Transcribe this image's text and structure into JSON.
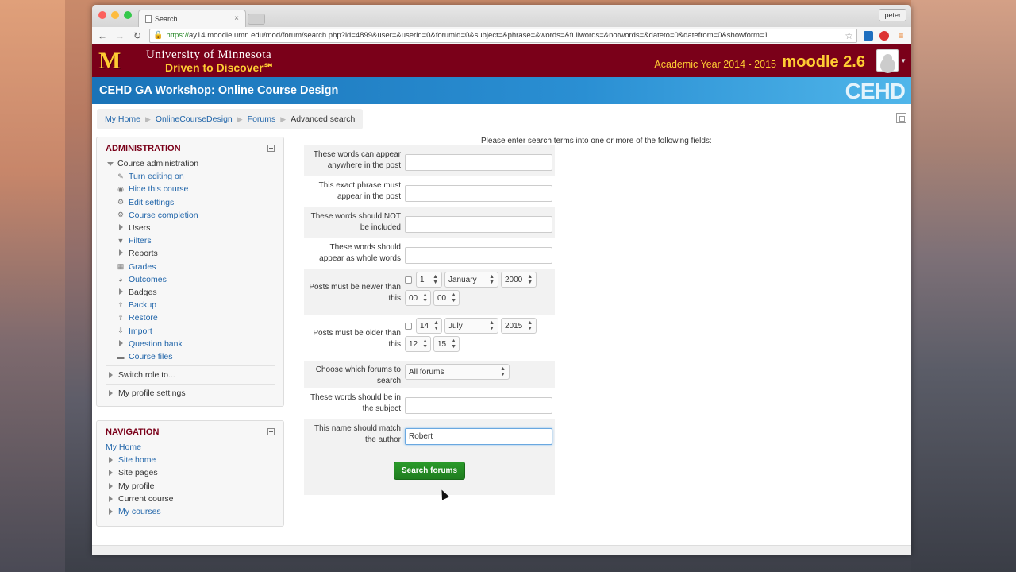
{
  "browser": {
    "tab_title": "Search",
    "user": "peter",
    "url_scheme": "https://",
    "url_rest": "ay14.moodle.umn.edu/mod/forum/search.php?id=4899&user=&userid=0&forumid=0&subject=&phrase=&words=&fullwords=&notwords=&dateto=0&datefrom=0&showform=1"
  },
  "header": {
    "logo_letter": "M",
    "university": "University of Minnesota",
    "tagline": "Driven to Discover℠",
    "academic_year": "Academic Year 2014 - 2015",
    "moodle_version": "moodle 2.6"
  },
  "course_bar": {
    "title": "CEHD GA Workshop: Online Course Design",
    "brand": "CEHD"
  },
  "breadcrumb": [
    "My Home",
    "OnlineCourseDesign",
    "Forums",
    "Advanced search"
  ],
  "admin_block": {
    "title": "ADMINISTRATION",
    "course_admin": "Course administration",
    "items": [
      {
        "label": "Turn editing on",
        "icon": "pencil-icon",
        "link": true,
        "arrow": false
      },
      {
        "label": "Hide this course",
        "icon": "eye-icon",
        "link": true,
        "arrow": false
      },
      {
        "label": "Edit settings",
        "icon": "gear-icon",
        "link": true,
        "arrow": false
      },
      {
        "label": "Course completion",
        "icon": "gear-icon",
        "link": true,
        "arrow": false
      },
      {
        "label": "Users",
        "icon": "",
        "link": false,
        "arrow": true
      },
      {
        "label": "Filters",
        "icon": "filter-icon",
        "link": true,
        "arrow": false
      },
      {
        "label": "Reports",
        "icon": "",
        "link": false,
        "arrow": true
      },
      {
        "label": "Grades",
        "icon": "grades-icon",
        "link": true,
        "arrow": false
      },
      {
        "label": "Outcomes",
        "icon": "outcomes-icon",
        "link": true,
        "arrow": false
      },
      {
        "label": "Badges",
        "icon": "",
        "link": false,
        "arrow": true
      },
      {
        "label": "Backup",
        "icon": "backup-icon",
        "link": true,
        "arrow": false
      },
      {
        "label": "Restore",
        "icon": "restore-icon",
        "link": true,
        "arrow": false
      },
      {
        "label": "Import",
        "icon": "import-icon",
        "link": true,
        "arrow": false
      },
      {
        "label": "Question bank",
        "icon": "",
        "link": true,
        "arrow": true
      },
      {
        "label": "Course files",
        "icon": "folder-icon",
        "link": true,
        "arrow": false
      }
    ],
    "switch_role": "Switch role to...",
    "profile_settings": "My profile settings"
  },
  "nav_block": {
    "title": "NAVIGATION",
    "home": "My Home",
    "items": [
      {
        "label": "Site home",
        "link": true
      },
      {
        "label": "Site pages",
        "link": false
      },
      {
        "label": "My profile",
        "link": false
      },
      {
        "label": "Current course",
        "link": false
      },
      {
        "label": "My courses",
        "link": true
      }
    ]
  },
  "search_form": {
    "intro": "Please enter search terms into one or more of the following fields:",
    "words_label": "These words can appear anywhere in the post",
    "words_value": "",
    "phrase_label": "This exact phrase must appear in the post",
    "phrase_value": "",
    "notwords_label": "These words should NOT be included",
    "notwords_value": "",
    "fullwords_label": "These words should appear as whole words",
    "fullwords_value": "",
    "newer_label": "Posts must be newer than this",
    "newer": {
      "day": "1",
      "month": "January",
      "year": "2000",
      "hour": "00",
      "minute": "00"
    },
    "older_label": "Posts must be older than this",
    "older": {
      "day": "14",
      "month": "July",
      "year": "2015",
      "hour": "12",
      "minute": "15"
    },
    "forum_label": "Choose which forums to search",
    "forum_value": "All forums",
    "subject_label": "These words should be in the subject",
    "subject_value": "",
    "author_label": "This name should match the author",
    "author_value": "Robert",
    "submit_label": "Search forums"
  }
}
